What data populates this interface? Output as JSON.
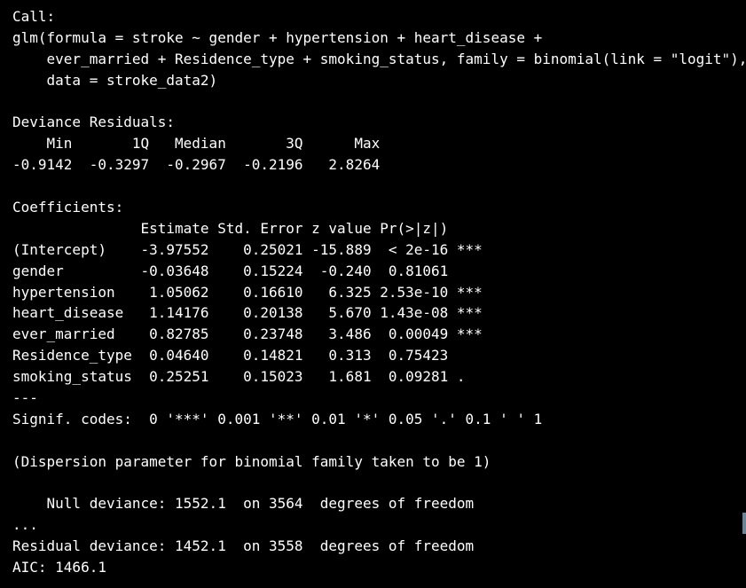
{
  "console": {
    "lines": [
      "Call:",
      "glm(formula = stroke ~ gender + hypertension + heart_disease + ",
      "    ever_married + Residence_type + smoking_status, family = binomial(link = \"logit\"),",
      "    data = stroke_data2)",
      "",
      "Deviance Residuals: ",
      "    Min       1Q   Median       3Q      Max  ",
      "-0.9142  -0.3297  -0.2967  -0.2196   2.8264  ",
      "",
      "Coefficients:",
      "               Estimate Std. Error z value Pr(>|z|)    ",
      "(Intercept)    -3.97552    0.25021 -15.889  < 2e-16 ***",
      "gender         -0.03648    0.15224  -0.240  0.81061    ",
      "hypertension    1.05062    0.16610   6.325 2.53e-10 ***",
      "heart_disease   1.14176    0.20138   5.670 1.43e-08 ***",
      "ever_married    0.82785    0.23748   3.486  0.00049 ***",
      "Residence_type  0.04640    0.14821   0.313  0.75423    ",
      "smoking_status  0.25251    0.15023   1.681  0.09281 .  ",
      "---",
      "Signif. codes:  0 '***' 0.001 '**' 0.01 '*' 0.05 '.' 0.1 ' ' 1",
      "",
      "(Dispersion parameter for binomial family taken to be 1)",
      "",
      "    Null deviance: 1552.1  on 3564  degrees of freedom",
      "...",
      "Residual deviance: 1452.1  on 3558  degrees of freedom",
      "AIC: 1466.1"
    ]
  },
  "colors": {
    "background": "#000000",
    "text": "#ffffff",
    "scroll_marker": "#6a8597"
  }
}
